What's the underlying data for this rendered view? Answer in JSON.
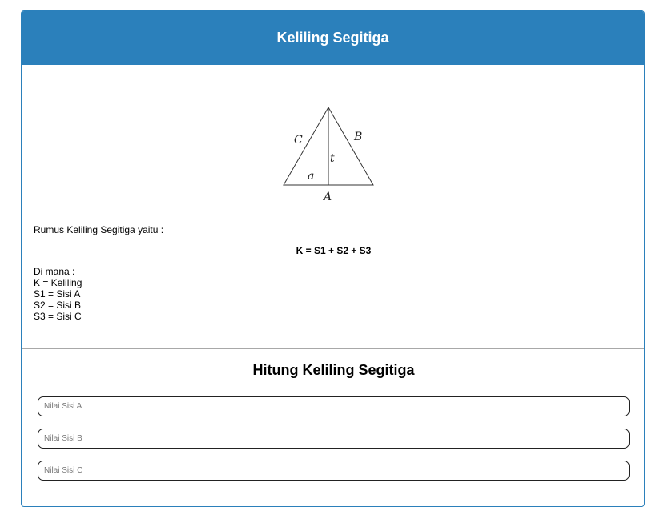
{
  "header": {
    "title": "Keliling Segitiga"
  },
  "diagram": {
    "labels": {
      "side_c": "C",
      "side_b": "B",
      "height": "t",
      "angle": "a",
      "base": "A"
    }
  },
  "content": {
    "intro": "Rumus Keliling Segitiga yaitu :",
    "formula": "K = S1 + S2 + S3",
    "legend_title": "Di mana :",
    "legend": [
      "K = Keliling",
      "S1 = Sisi A",
      "S2 = Sisi B",
      "S3 = Sisi C"
    ]
  },
  "calculator": {
    "title": "Hitung Keliling Segitiga",
    "fields": [
      {
        "placeholder": "Nilai Sisi A",
        "value": ""
      },
      {
        "placeholder": "Nilai Sisi B",
        "value": ""
      },
      {
        "placeholder": "Nilai Sisi C",
        "value": ""
      }
    ]
  },
  "colors": {
    "accent": "#2b80bb",
    "divider": "#a8a8a8"
  }
}
